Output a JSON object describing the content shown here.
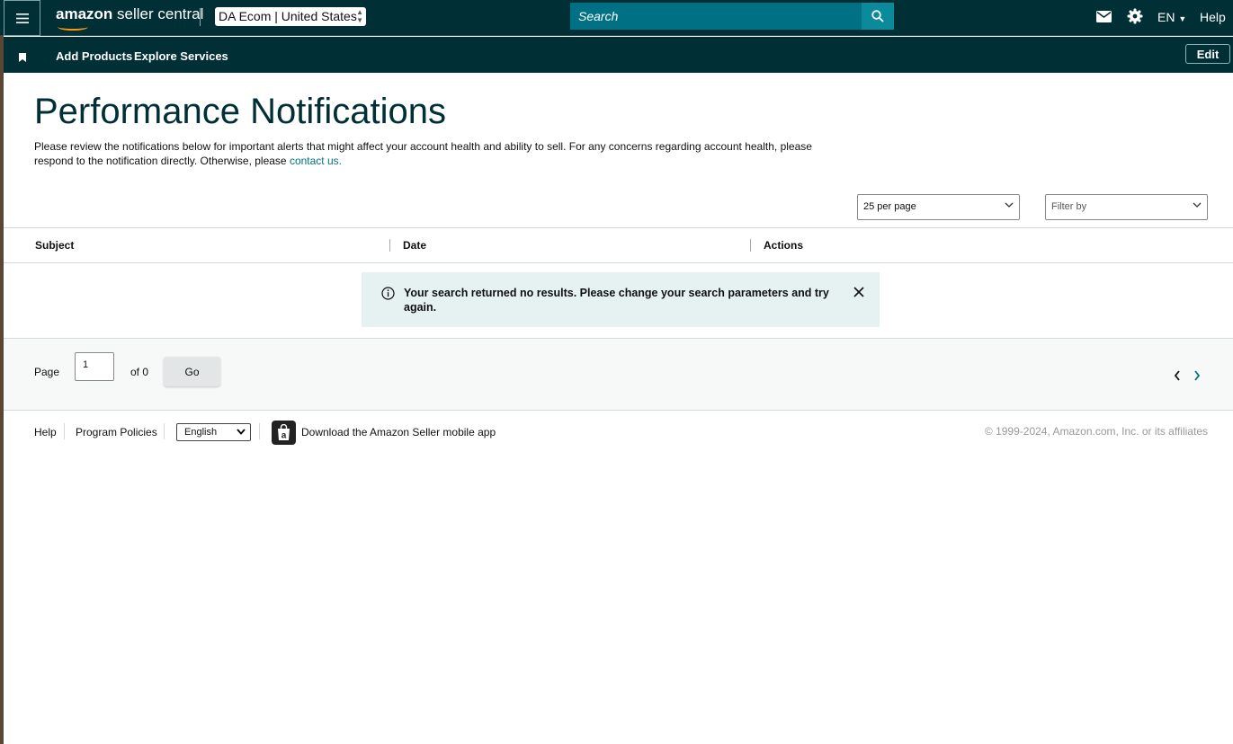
{
  "header": {
    "menu_icon": "hamburger-menu-icon",
    "logo_text_bold": "amazon",
    "logo_text": " seller central",
    "account_name": "DA Ecom",
    "account_region": "United States",
    "search_placeholder": "Search",
    "lang": "EN",
    "help": "Help"
  },
  "navbar": {
    "links": [
      "Add Products",
      "Explore Services"
    ],
    "edit_label": "Edit"
  },
  "page": {
    "title": "Performance Notifications",
    "description": "Please review the notifications below for important alerts that might affect your account health and ability to sell. For any concerns regarding account health, please respond to the notification directly. Otherwise, please ",
    "contact_link": "contact us."
  },
  "controls": {
    "per_page": "25 per page",
    "filter_placeholder": "Filter by"
  },
  "table": {
    "columns": [
      "Subject",
      "Date",
      "Actions"
    ],
    "rows": []
  },
  "alert": {
    "message": "Your search returned no results. Please change your search parameters and try again."
  },
  "pagination": {
    "page_label": "Page",
    "current_page": "1",
    "of_label": "of 0",
    "go_label": "Go"
  },
  "footer": {
    "help": "Help",
    "policies": "Program Policies",
    "language": "English",
    "app_link": "Download the Amazon Seller mobile app",
    "copyright": "© 1999-2024, Amazon.com, Inc. or its affiliates"
  },
  "colors": {
    "header_bg": "#002f36",
    "search_bg": "#007185",
    "link": "#007185",
    "alert_bg": "#e6f1f2",
    "accent_smile": "#ff9900"
  }
}
